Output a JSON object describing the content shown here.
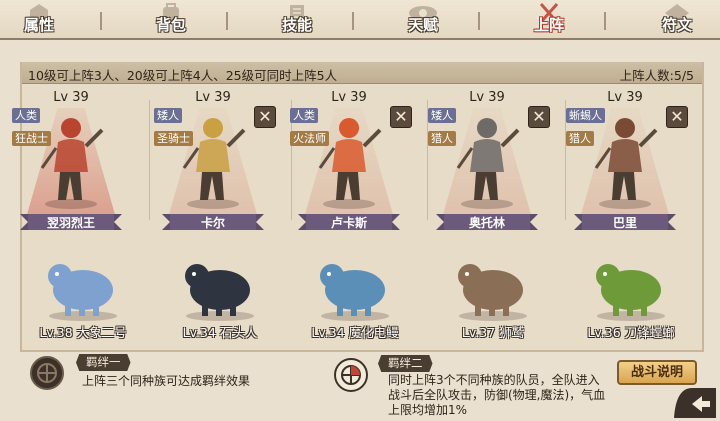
{
  "tabs": [
    {
      "label": "属性",
      "icon": "attribute-icon",
      "active": false
    },
    {
      "label": "背包",
      "icon": "bag-icon",
      "active": false
    },
    {
      "label": "技能",
      "icon": "skill-icon",
      "active": false
    },
    {
      "label": "天赋",
      "icon": "talent-eye-icon",
      "active": false
    },
    {
      "label": "上阵",
      "icon": "crossed-swords-icon",
      "active": true
    },
    {
      "label": "符文",
      "icon": "rune-icon",
      "active": false
    }
  ],
  "formation": {
    "rule": "10级可上阵3人、20级可上阵4人、25级可同时上阵5人",
    "count_label": "上阵人数:5/5"
  },
  "heroes": [
    {
      "level": "Lv 39",
      "race": "人类",
      "class": "狂战士",
      "name": "翌羽烈王",
      "removable": false,
      "highlight": true,
      "color": "#b9442f"
    },
    {
      "level": "Lv 39",
      "race": "矮人",
      "class": "圣骑士",
      "name": "卡尔",
      "removable": true,
      "highlight": false,
      "color": "#c9a043"
    },
    {
      "level": "Lv 39",
      "race": "人类",
      "class": "火法师",
      "name": "卢卡斯",
      "removable": true,
      "highlight": false,
      "color": "#d95a2e"
    },
    {
      "level": "Lv 39",
      "race": "矮人",
      "class": "猎人",
      "name": "奥托林",
      "removable": true,
      "highlight": false,
      "color": "#6d6a68"
    },
    {
      "level": "Lv 39",
      "race": "蜥蜴人",
      "class": "猎人",
      "name": "巴里",
      "removable": true,
      "highlight": false,
      "color": "#7a4a34"
    }
  ],
  "pets": [
    {
      "label": "Lv.38 大象二号",
      "color": "#7ea1cf"
    },
    {
      "label": "Lv.34 石头人",
      "color": "#2e3440"
    },
    {
      "label": "Lv.34 魔化电鳗",
      "color": "#5c8fb8"
    },
    {
      "label": "Lv.37 狮鹫",
      "color": "#8a6f56"
    },
    {
      "label": "Lv.36 刀锋螳螂",
      "color": "#6f9a3a"
    }
  ],
  "bonds": [
    {
      "title": "羁绊一",
      "description": "上阵三个同种族可达成羁绊效果"
    },
    {
      "title": "羁绊二",
      "description_lines": [
        "同时上阵3个不同种族的队员，全队进入",
        "战斗后全队攻击，防御(物理,魔法)，气血",
        "上限均增加1%"
      ]
    }
  ],
  "buttons": {
    "battle_info": "战斗说明"
  }
}
